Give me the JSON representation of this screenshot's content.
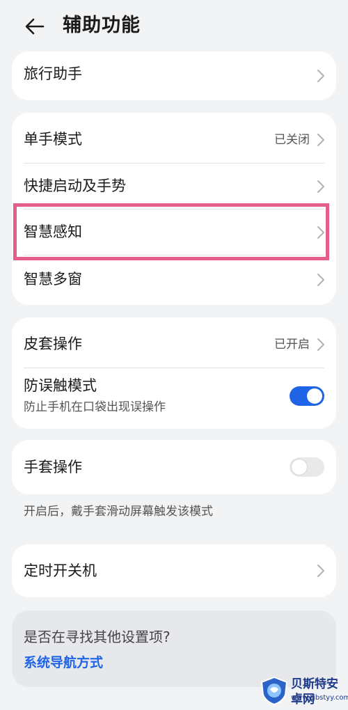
{
  "header": {
    "title": "辅助功能"
  },
  "travel": {
    "label": "旅行助手"
  },
  "group1": {
    "one_hand": {
      "label": "单手模式",
      "value": "已关闭"
    },
    "shortcut": {
      "label": "快捷启动及手势"
    },
    "smart_sense": {
      "label": "智慧感知"
    },
    "multi_window": {
      "label": "智慧多窗"
    }
  },
  "group2": {
    "cover": {
      "label": "皮套操作",
      "value": "已开启"
    },
    "anti_touch": {
      "label": "防误触模式",
      "sub": "防止手机在口袋出现误操作",
      "enabled": true
    }
  },
  "glove": {
    "label": "手套操作",
    "enabled": false,
    "hint": "开启后，戴手套滑动屏幕触发该模式"
  },
  "timer": {
    "label": "定时开关机"
  },
  "search": {
    "question": "是否在寻找其他设置项?",
    "link": "系统导航方式"
  },
  "watermark": {
    "title": "贝斯特安卓网",
    "url": "www.zjbstyy.com"
  },
  "colors": {
    "accent": "#1f64e6",
    "highlight": "#e35e8b",
    "background": "#f1f3f5"
  }
}
